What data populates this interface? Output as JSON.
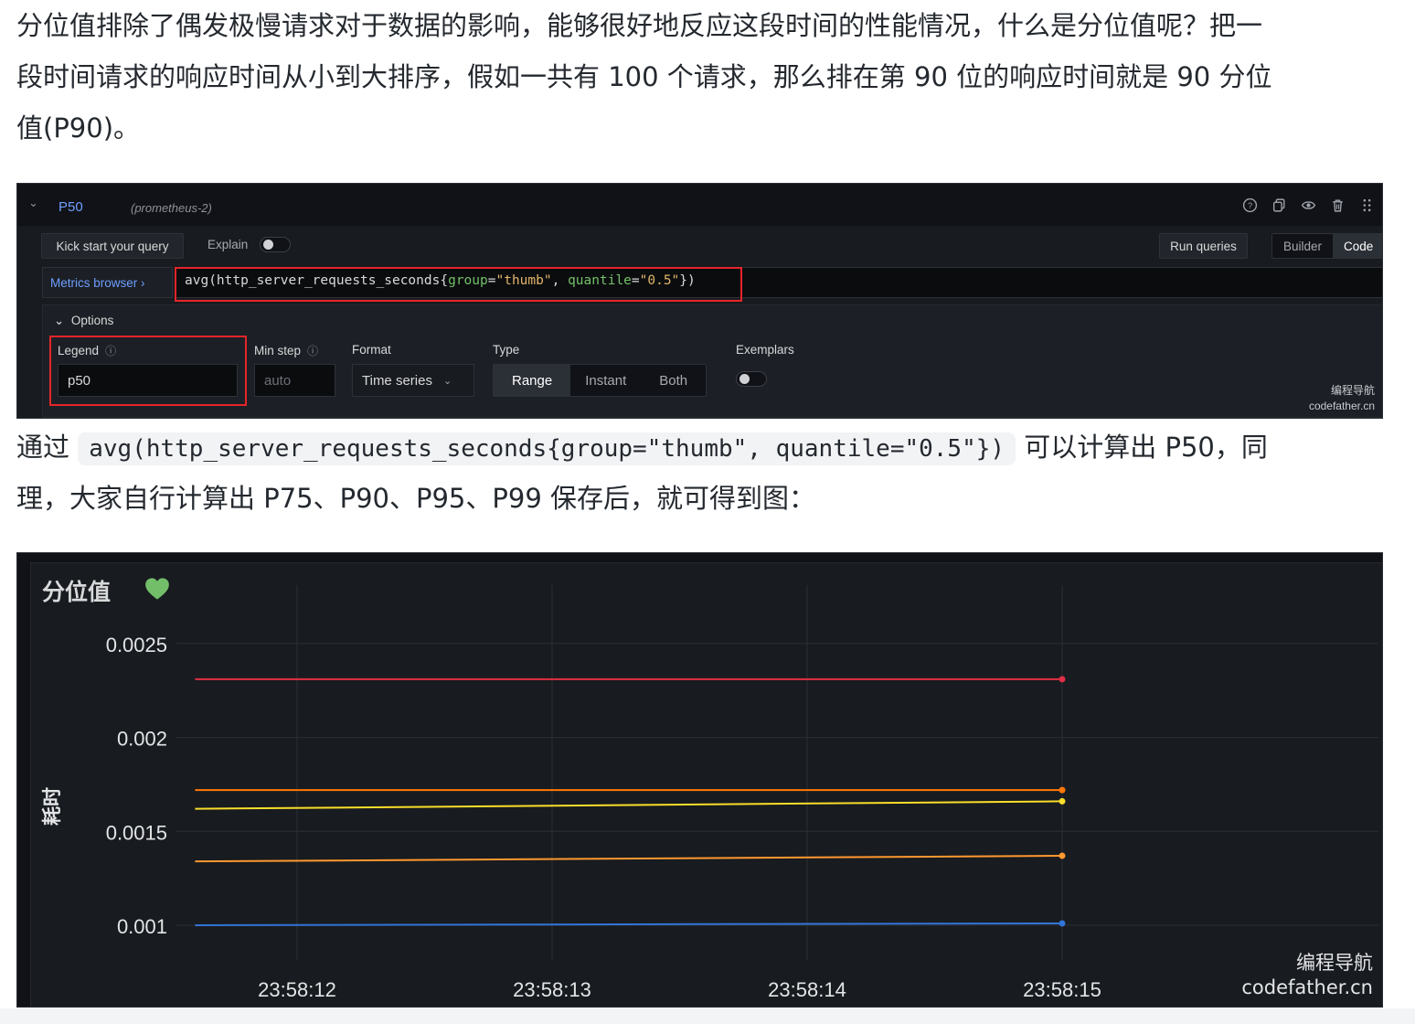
{
  "article": {
    "para1_line1": "分位值排除了偶发极慢请求对于数据的影响，能够很好地反应这段时间的性能情况，什么是分位值呢？把一",
    "para1_line2": "段时间请求的响应时间从小到大排序，假如一共有 100 个请求，那么排在第 90 位的响应时间就是 90 分位",
    "para1_line3": "值(P90)。",
    "para2_prefix": "通过",
    "para2_code": "avg(http_server_requests_seconds{group=\"thumb\", quantile=\"0.5\"})",
    "para2_suffix": "可以计算出 P50，同",
    "para2_line2": "理，大家自行计算出 P75、P90、P95、P99 保存后，就可得到图："
  },
  "query_editor": {
    "query_name": "P50",
    "datasource": "(prometheus-2)",
    "kick_start_label": "Kick start your query",
    "explain_label": "Explain",
    "run_queries_label": "Run queries",
    "mode_builder": "Builder",
    "mode_code": "Code",
    "metrics_browser_label": "Metrics browser ›",
    "query": {
      "fn": "avg(",
      "metric": "http_server_requests_seconds{",
      "label1": "group",
      "eq1": "=",
      "val1": "\"thumb\"",
      "sep": ", ",
      "label2": "quantile",
      "eq2": "=",
      "val2": "\"0.5\"",
      "close": "})"
    },
    "options_label": "Options",
    "legend_label": "Legend",
    "legend_value": "p50",
    "min_step_label": "Min step",
    "min_step_placeholder": "auto",
    "format_label": "Format",
    "format_value": "Time series",
    "type_label": "Type",
    "type_options": [
      "Range",
      "Instant",
      "Both"
    ],
    "exemplars_label": "Exemplars",
    "watermark_line1": "编程导航",
    "watermark_line2": "codefather.cn"
  },
  "chart_panel": {
    "title": "分位值",
    "watermark_line1": "编程导航",
    "watermark_line2": "codefather.cn"
  },
  "chart_data": {
    "type": "line",
    "title": "分位值",
    "ylabel": "耗时",
    "xlabel": "",
    "x_ticks": [
      "23:58:12",
      "23:58:13",
      "23:58:14",
      "23:58:15"
    ],
    "y_ticks": [
      "0.0025",
      "0.002",
      "0.0015",
      "0.001"
    ],
    "ylim": [
      0.0009,
      0.0026
    ],
    "x": [
      "23:58:11.6",
      "23:58:15"
    ],
    "series": [
      {
        "color": "#e02f44",
        "values": [
          0.00231,
          0.00231
        ]
      },
      {
        "color": "#ff780a",
        "values": [
          0.00172,
          0.00172
        ]
      },
      {
        "color": "#fade2a",
        "values": [
          0.00162,
          0.00166
        ]
      },
      {
        "color": "#ff9830",
        "values": [
          0.00134,
          0.00137
        ]
      },
      {
        "color": "#3274d9",
        "values": [
          0.001,
          0.00101
        ]
      }
    ],
    "grid": true,
    "legend": "none"
  }
}
